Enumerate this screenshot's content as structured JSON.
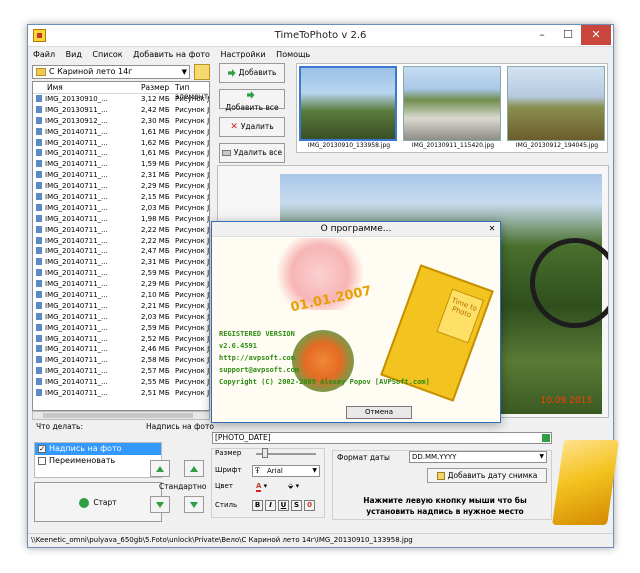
{
  "window": {
    "title": "TimeToPhoto v 2.6",
    "controls": {
      "minimize": "–",
      "maximize": "☐",
      "close": "✕"
    }
  },
  "menu": [
    "Файл",
    "Вид",
    "Список",
    "Добавить на фото",
    "Настройки",
    "Помощь"
  ],
  "folder_combo": {
    "value": "С Кариной лето 14г"
  },
  "file_list": {
    "columns": [
      "Имя",
      "Размер",
      "Тип элемента"
    ],
    "rows": [
      {
        "name": "IMG_20130910_...",
        "size": "3,12 МБ",
        "type": "Рисунок JPEG"
      },
      {
        "name": "IMG_20130911_...",
        "size": "2,42 МБ",
        "type": "Рисунок JPEG"
      },
      {
        "name": "IMG_20130912_...",
        "size": "2,30 МБ",
        "type": "Рисунок JPEG"
      },
      {
        "name": "IMG_20140711_...",
        "size": "1,61 МБ",
        "type": "Рисунок JPEG"
      },
      {
        "name": "IMG_20140711_...",
        "size": "1,62 МБ",
        "type": "Рисунок JPEG"
      },
      {
        "name": "IMG_20140711_...",
        "size": "1,61 МБ",
        "type": "Рисунок JPEG"
      },
      {
        "name": "IMG_20140711_...",
        "size": "1,59 МБ",
        "type": "Рисунок JPEG"
      },
      {
        "name": "IMG_20140711_...",
        "size": "2,31 МБ",
        "type": "Рисунок JPEG"
      },
      {
        "name": "IMG_20140711_...",
        "size": "2,29 МБ",
        "type": "Рисунок JPEG"
      },
      {
        "name": "IMG_20140711_...",
        "size": "2,15 МБ",
        "type": "Рисунок JPEG"
      },
      {
        "name": "IMG_20140711_...",
        "size": "2,03 МБ",
        "type": "Рисунок JPEG"
      },
      {
        "name": "IMG_20140711_...",
        "size": "1,98 МБ",
        "type": "Рисунок JPEG"
      },
      {
        "name": "IMG_20140711_...",
        "size": "2,22 МБ",
        "type": "Рисунок JPEG"
      },
      {
        "name": "IMG_20140711_...",
        "size": "2,22 МБ",
        "type": "Рисунок JPEG"
      },
      {
        "name": "IMG_20140711_...",
        "size": "2,47 МБ",
        "type": "Рисунок JPEG"
      },
      {
        "name": "IMG_20140711_...",
        "size": "2,31 МБ",
        "type": "Рисунок JPEG"
      },
      {
        "name": "IMG_20140711_...",
        "size": "2,59 МБ",
        "type": "Рисунок JPEG"
      },
      {
        "name": "IMG_20140711_...",
        "size": "2,29 МБ",
        "type": "Рисунок JPEG"
      },
      {
        "name": "IMG_20140711_...",
        "size": "2,10 МБ",
        "type": "Рисунок JPEG"
      },
      {
        "name": "IMG_20140711_...",
        "size": "2,21 МБ",
        "type": "Рисунок JPEG"
      },
      {
        "name": "IMG_20140711_...",
        "size": "2,03 МБ",
        "type": "Рисунок JPEG"
      },
      {
        "name": "IMG_20140711_...",
        "size": "2,59 МБ",
        "type": "Рисунок JPEG"
      },
      {
        "name": "IMG_20140711_...",
        "size": "2,52 МБ",
        "type": "Рисунок JPEG"
      },
      {
        "name": "IMG_20140711_...",
        "size": "2,46 МБ",
        "type": "Рисунок JPEG"
      },
      {
        "name": "IMG_20140711_...",
        "size": "2,58 МБ",
        "type": "Рисунок JPEG"
      },
      {
        "name": "IMG_20140711_...",
        "size": "2,57 МБ",
        "type": "Рисунок JPEG"
      },
      {
        "name": "IMG_20140711_...",
        "size": "2,55 МБ",
        "type": "Рисунок JPEG"
      },
      {
        "name": "IMG_20140711_...",
        "size": "2,51 МБ",
        "type": "Рисунок JPEG"
      }
    ]
  },
  "buttons": {
    "add": "Добавить",
    "add_all": "Добавить все",
    "remove": "Удалить",
    "remove_all": "Удалить все"
  },
  "thumbnails": [
    {
      "caption": "IMG_20130910_133958.jpg"
    },
    {
      "caption": "IMG_20130911_115420.jpg"
    },
    {
      "caption": "IMG_20130912_194045.jpg"
    }
  ],
  "preview": {
    "date_stamp": "10.09.2013"
  },
  "about_dialog": {
    "title": "О программе...",
    "close": "✕",
    "stamp_date": "01.01.2007",
    "stamp_logo": "Time to Photo",
    "lines": [
      "REGISTERED VERSION",
      "v2.6.4591",
      "http://avpsoft.com",
      "support@avpsoft.com",
      "Copyright (C) 2002-2009 Alexey Popov [AVPSoft.com]"
    ],
    "ok_button": "Отмена"
  },
  "bottom": {
    "what_label": "Что делать:",
    "actions": [
      {
        "label": "Надпись на фото",
        "checked": "✓"
      },
      {
        "label": "Переименовать",
        "checked": ""
      }
    ],
    "start_button": "Старт",
    "caption_label": "Надпись на фото",
    "standard_label": "Стандартно",
    "caption_value": "[PHOTO_DATE]",
    "size_label": "Размер",
    "font_label": "Шрифт",
    "font_value": "Arial",
    "color_label": "Цвет",
    "style_label": "Стиль",
    "style_buttons": [
      "B",
      "I",
      "U",
      "S",
      "0"
    ],
    "date_format_label": "Формат даты",
    "date_format_value": "DD.MM.YYYY",
    "add_date_button": "Добавить дату снимка",
    "hint": "Нажмите левую кнопку мыши что бы установить надпись в нужное место"
  },
  "status_path": "\\\\Keenetic_omni\\pulyava_650gb\\5.Foto\\unlock\\Private\\Вело\\С Кариной лето 14г\\IMG_20130910_133958.jpg"
}
